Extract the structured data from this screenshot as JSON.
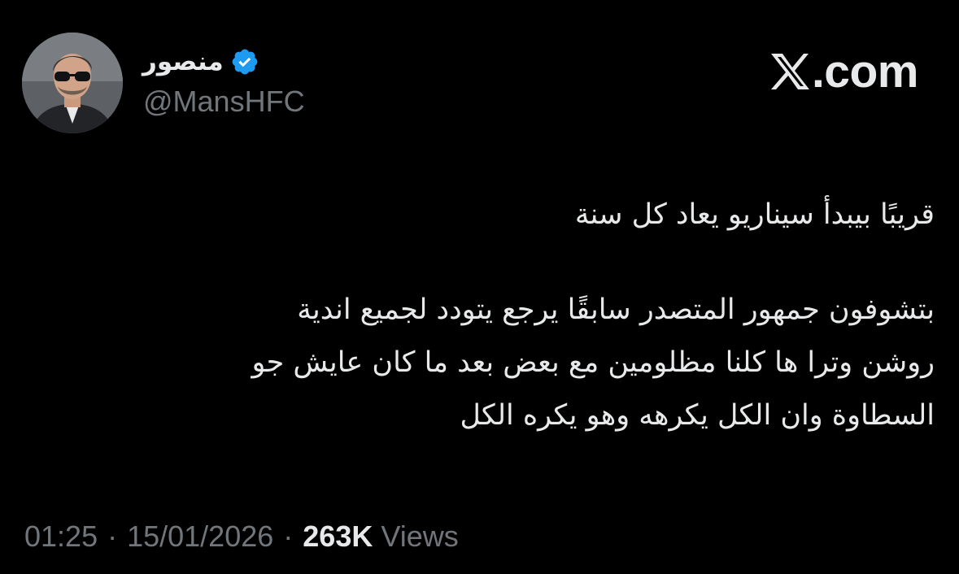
{
  "author": {
    "display_name": "منصور",
    "handle": "@MansHFC",
    "verified": true
  },
  "brand": {
    "icon": "x-logo-icon",
    "domain": ".com"
  },
  "tweet": {
    "lines": [
      "قريبًا بيبدأ سيناريو يعاد كل سنة",
      "بتشوفون جمهور المتصدر سابقًا يرجع يتودد لجميع اندية",
      "روشن وترا ها كلنا مظلومين مع بعض بعد ما كان عايش جو",
      "السطاوة وان الكل يكرهه وهو يكره الكل"
    ]
  },
  "meta": {
    "time": "01:25",
    "separator": "·",
    "date": "15/01/2026",
    "views_count": "263K",
    "views_label": "Views"
  },
  "colors": {
    "background": "#000000",
    "text_primary": "#e7e9ea",
    "text_secondary": "#71767b",
    "verified_badge": "#1d9bf0"
  }
}
